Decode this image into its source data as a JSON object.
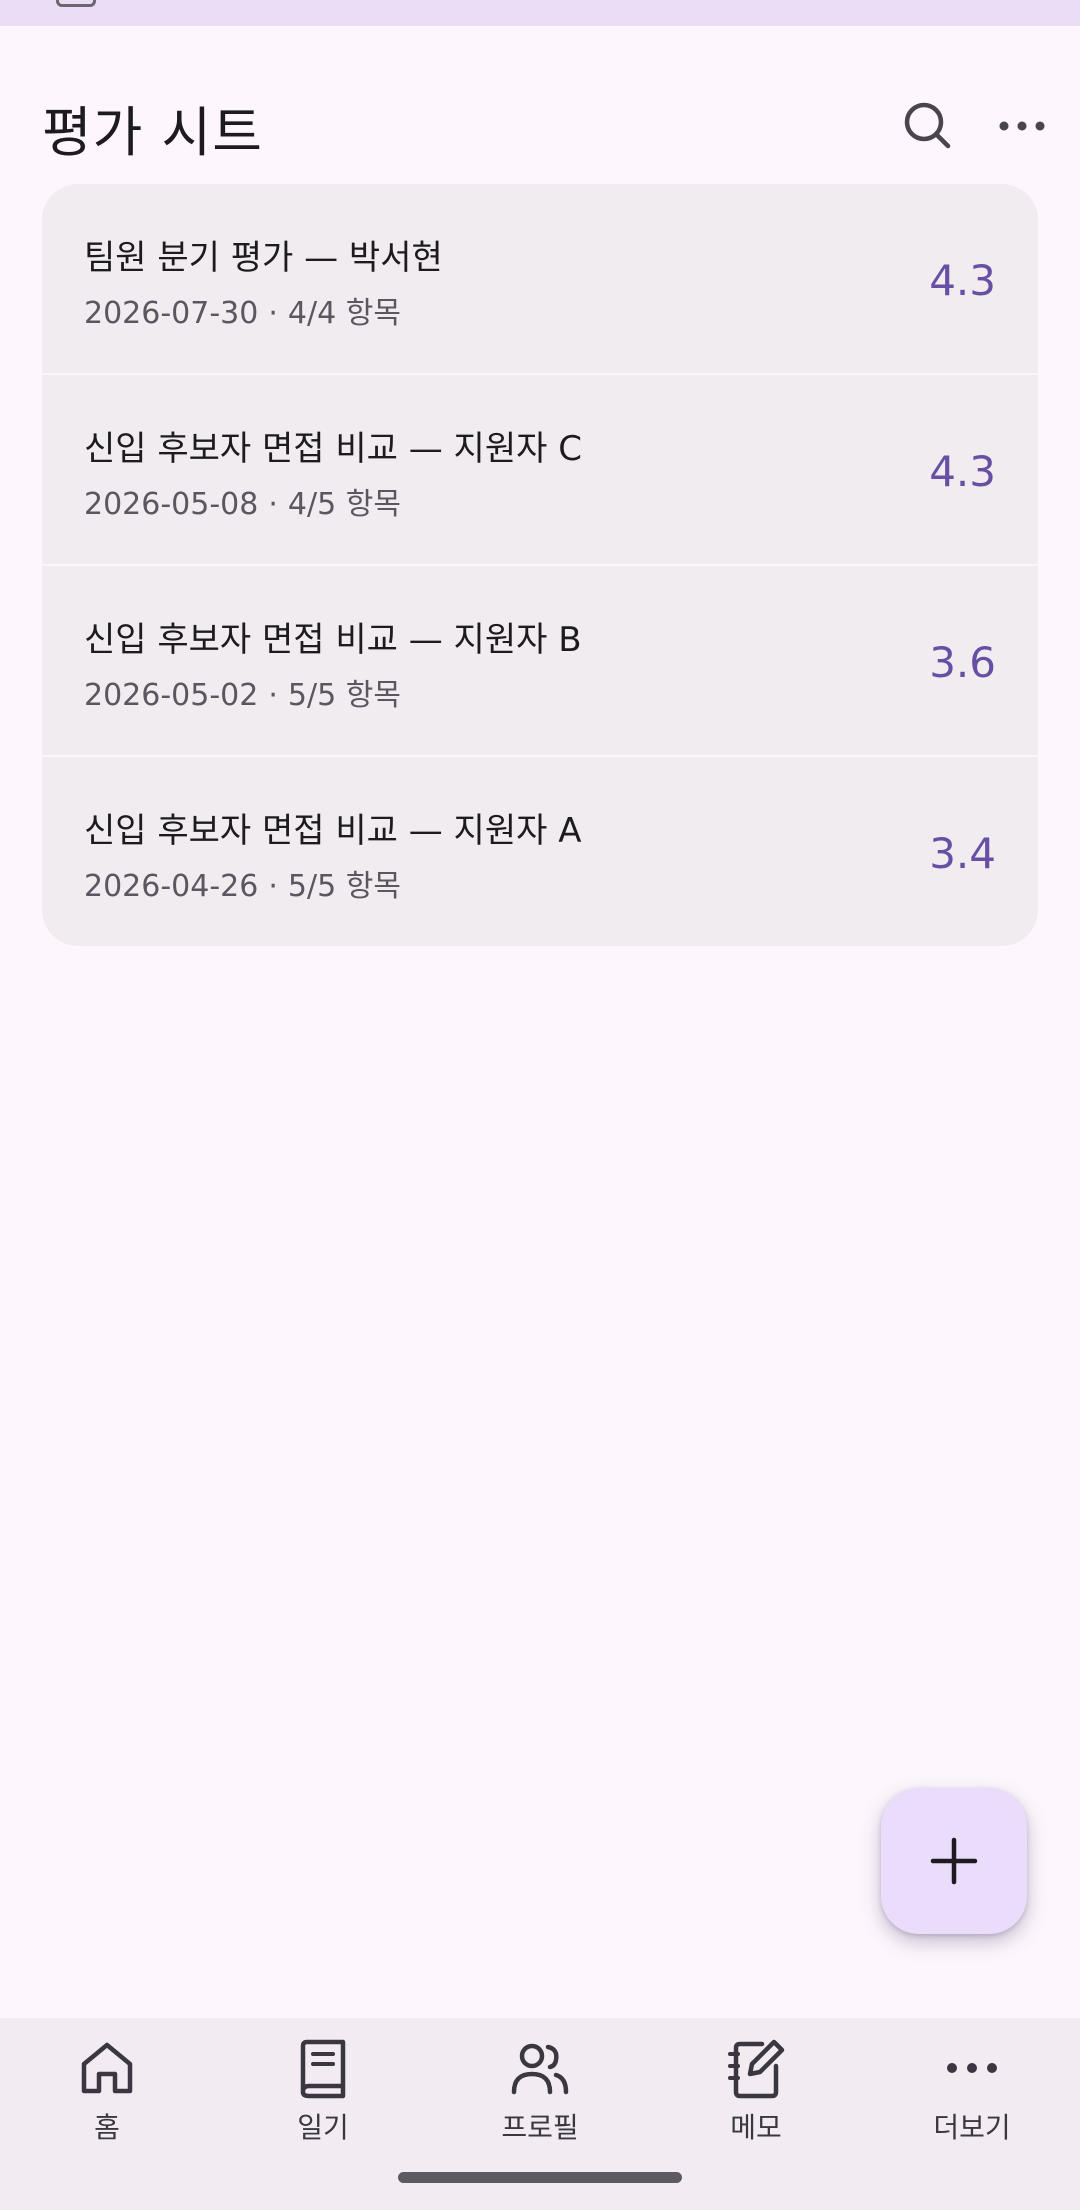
{
  "header": {
    "title": "평가 시트"
  },
  "sheets": [
    {
      "title": "팀원 분기 평가 — 박서현",
      "date": "2026-07-30",
      "separator": "·",
      "progress": "4/4 항목",
      "score": "4.3"
    },
    {
      "title": "신입 후보자 면접 비교 — 지원자 C",
      "date": "2026-05-08",
      "separator": "·",
      "progress": "4/5 항목",
      "score": "4.3"
    },
    {
      "title": "신입 후보자 면접 비교 — 지원자 B",
      "date": "2026-05-02",
      "separator": "·",
      "progress": "5/5 항목",
      "score": "3.6"
    },
    {
      "title": "신입 후보자 면접 비교 — 지원자 A",
      "date": "2026-04-26",
      "separator": "·",
      "progress": "5/5 항목",
      "score": "3.4"
    }
  ],
  "nav": {
    "items": [
      {
        "label": "홈",
        "icon": "home-icon"
      },
      {
        "label": "일기",
        "icon": "book-icon"
      },
      {
        "label": "프로필",
        "icon": "people-icon"
      },
      {
        "label": "메모",
        "icon": "notebook-pen-icon"
      },
      {
        "label": "더보기",
        "icon": "more-horizontal-icon"
      }
    ]
  },
  "colors": {
    "accent": "#6750a4",
    "background": "#fdf7fd",
    "card": "#f1ecf0",
    "fab": "#e9ddfb",
    "nav": "#f2ecf2"
  }
}
